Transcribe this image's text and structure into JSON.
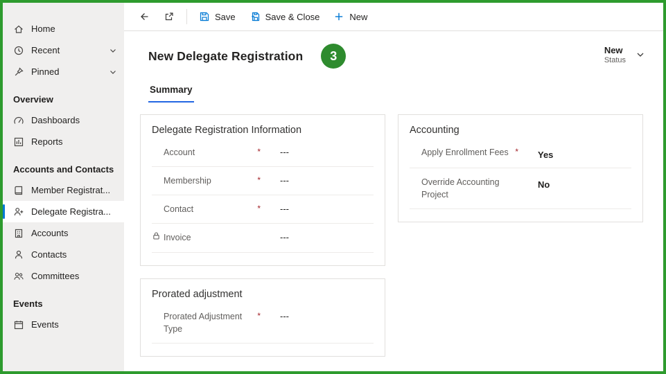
{
  "colors": {
    "frame_green": "#2e9b2e",
    "badge_green": "#2e8b2e",
    "accent_blue": "#0078d4",
    "tab_underline_blue": "#2266e3",
    "required_red": "#a4262c"
  },
  "icons": {
    "hamburger": "hamburger-icon",
    "home": "home-icon",
    "recent": "clock-icon",
    "pinned": "pin-icon",
    "dashboards": "gauge-icon",
    "reports": "report-chart-icon",
    "member_registrations": "book-icon",
    "delegate_registrations": "person-add-icon",
    "accounts": "building-icon",
    "contacts": "person-icon",
    "committees": "people-icon",
    "events": "calendar-icon",
    "back": "back-arrow-icon",
    "popout": "popout-icon",
    "save": "save-icon",
    "save_close": "save-close-icon",
    "new": "plus-icon",
    "chevron_down": "chevron-down-icon",
    "invoice_lock": "lock-icon"
  },
  "sidebar": {
    "top_items": [
      {
        "label": "Home"
      },
      {
        "label": "Recent"
      },
      {
        "label": "Pinned"
      }
    ],
    "groups": [
      {
        "label": "Overview",
        "items": [
          {
            "label": "Dashboards"
          },
          {
            "label": "Reports"
          }
        ]
      },
      {
        "label": "Accounts and Contacts",
        "items": [
          {
            "label": "Member Registrat..."
          },
          {
            "label": "Delegate Registra..."
          },
          {
            "label": "Accounts"
          },
          {
            "label": "Contacts"
          },
          {
            "label": "Committees"
          }
        ]
      },
      {
        "label": "Events",
        "items": [
          {
            "label": "Events"
          }
        ]
      }
    ]
  },
  "command_bar": {
    "save": "Save",
    "save_close": "Save & Close",
    "new": "New"
  },
  "header": {
    "title": "New Delegate Registration",
    "badge": "3",
    "status_value": "New",
    "status_label": "Status"
  },
  "tabs": {
    "summary": "Summary"
  },
  "cards": {
    "delegate_info": {
      "title": "Delegate Registration Information",
      "fields": [
        {
          "label": "Account",
          "required": "*",
          "value": "---"
        },
        {
          "label": "Membership",
          "required": "*",
          "value": "---"
        },
        {
          "label": "Contact",
          "required": "*",
          "value": "---"
        },
        {
          "label": "Invoice",
          "value": "---"
        }
      ]
    },
    "accounting": {
      "title": "Accounting",
      "fields": [
        {
          "label": "Apply Enrollment Fees",
          "required": "*",
          "value": "Yes"
        },
        {
          "label": "Override Accounting Project",
          "value": "No"
        }
      ]
    },
    "prorated": {
      "title": "Prorated adjustment",
      "fields": [
        {
          "label": "Prorated Adjustment Type",
          "required": "*",
          "value": "---"
        }
      ]
    }
  }
}
